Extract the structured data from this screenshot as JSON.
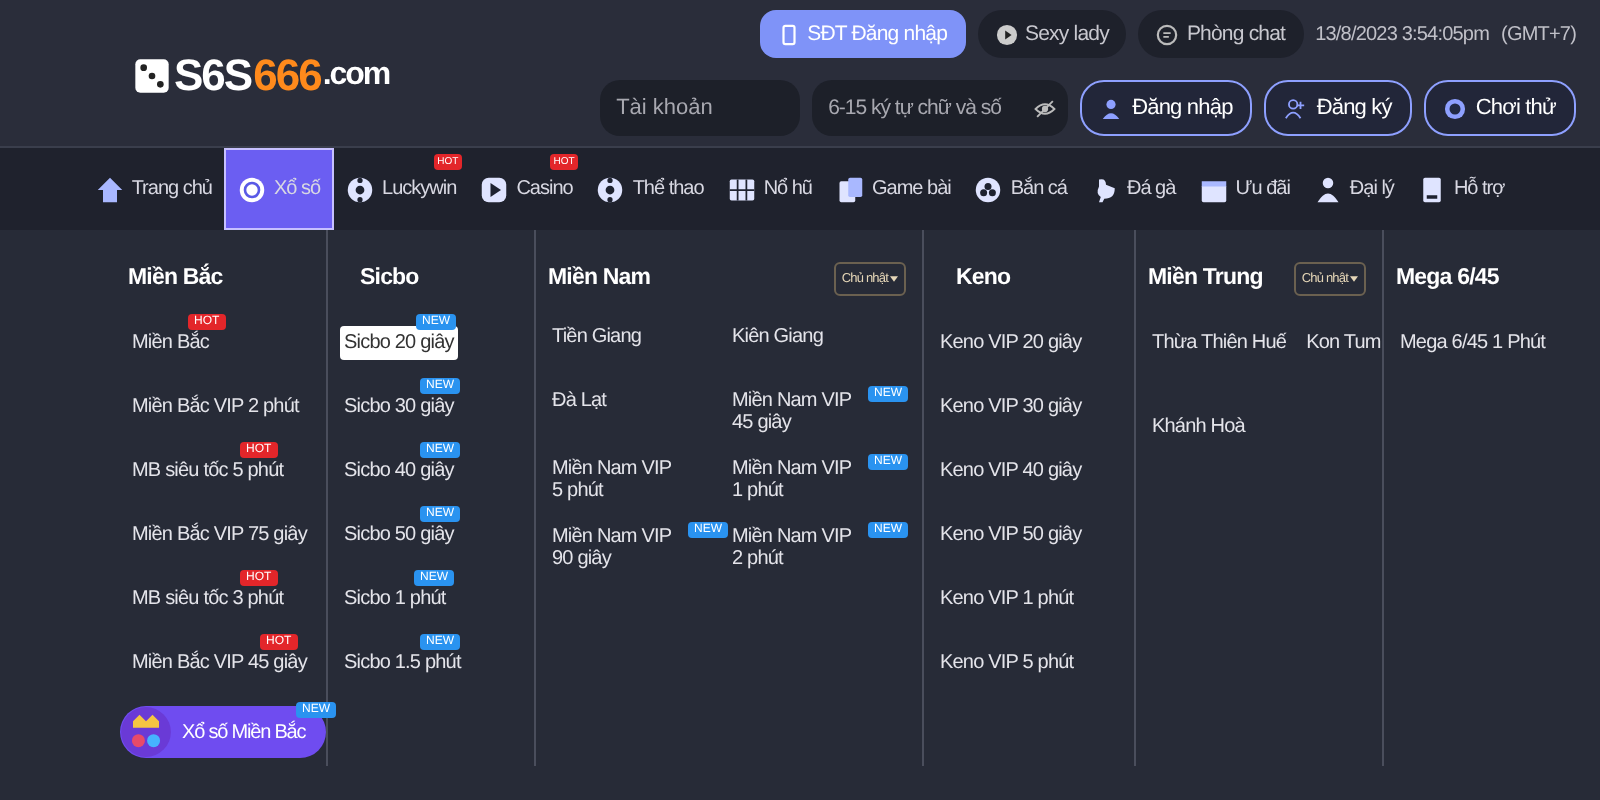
{
  "logo": {
    "prefix": "S6S",
    "accent": "666",
    "suffix": ".com"
  },
  "top_links": [
    {
      "label": "SĐT Đăng nhập",
      "kind": "primary"
    },
    {
      "label": "Sexy lady",
      "kind": "play"
    },
    {
      "label": "Phòng chat",
      "kind": "chat"
    }
  ],
  "clock": {
    "time": "13/8/2023 3:54:05pm",
    "zone": "(GMT+7)"
  },
  "login": {
    "account": {
      "placeholder": "Tài khoản"
    },
    "password": {
      "placeholder": "6-15 ký tự chữ và số"
    },
    "buttons": [
      {
        "label": "Đăng nhập",
        "kind": "login"
      },
      {
        "label": "Đăng ký",
        "kind": "register"
      },
      {
        "label": "Chơi thử",
        "kind": "trial"
      }
    ]
  },
  "nav": [
    {
      "label": "Trang chủ",
      "selected": false
    },
    {
      "label": "Xổ số",
      "selected": true
    },
    {
      "label": "Luckywin",
      "selected": false,
      "badge": "HOT"
    },
    {
      "label": "Casino",
      "selected": false,
      "badge": "HOT"
    },
    {
      "label": "Thể thao",
      "selected": false
    },
    {
      "label": "Nổ hũ",
      "selected": false
    },
    {
      "label": "Game bài",
      "selected": false
    },
    {
      "label": "Bắn cá",
      "selected": false
    },
    {
      "label": "Đá gà",
      "selected": false
    },
    {
      "label": "Ưu đãi",
      "selected": false
    },
    {
      "label": "Đại lý",
      "selected": false
    },
    {
      "label": "Hỗ trợ",
      "selected": false
    }
  ],
  "columns": [
    {
      "title": "Miền Bắc",
      "kind": "list",
      "items": [
        {
          "label": "Miền Bắc",
          "badge": {
            "text": "HOT",
            "kind": "hot"
          },
          "selected": false
        },
        {
          "label": "Miền Bắc VIP 2 phút",
          "selected": false
        },
        {
          "label": "MB siêu tốc 5 phút",
          "badge": {
            "text": "HOT",
            "kind": "hot"
          },
          "selected": false
        },
        {
          "label": "Miền Bắc VIP 75 giây",
          "selected": false
        },
        {
          "label": "MB siêu tốc 3 phút",
          "badge": {
            "text": "HOT",
            "kind": "hot"
          },
          "selected": false
        },
        {
          "label": "Miền Bắc VIP 45 giây",
          "badge": {
            "text": "HOT",
            "kind": "hot"
          },
          "selected": false
        },
        {
          "label": "Xổ số Miền Bắc",
          "kind": "feature",
          "badge": {
            "text": "NEW",
            "kind": "new"
          },
          "selected": false
        }
      ]
    },
    {
      "title": "Sicbo",
      "kind": "list",
      "items": [
        {
          "label": "Sicbo 20 giây",
          "badge": {
            "text": "NEW",
            "kind": "new"
          },
          "selected": true
        },
        {
          "label": "Sicbo 30 giây",
          "badge": {
            "text": "NEW",
            "kind": "new"
          },
          "selected": false
        },
        {
          "label": "Sicbo 40 giây",
          "badge": {
            "text": "NEW",
            "kind": "new"
          },
          "selected": false
        },
        {
          "label": "Sicbo 50 giây",
          "badge": {
            "text": "NEW",
            "kind": "new"
          },
          "selected": false
        },
        {
          "label": "Sicbo 1 phút",
          "badge": {
            "text": "NEW",
            "kind": "new"
          },
          "selected": false
        },
        {
          "label": "Sicbo 1.5 phút",
          "badge": {
            "text": "NEW",
            "kind": "new"
          },
          "selected": false
        }
      ]
    },
    {
      "title": "Miền Nam",
      "dropdown": "Chủ nhật",
      "kind": "grid",
      "items": [
        {
          "label": "Tiền Giang",
          "selected": false
        },
        {
          "label": "Kiên Giang",
          "selected": false
        },
        {
          "label": "Đà Lạt",
          "selected": false
        },
        {
          "label": "Miền Nam VIP 45 giây",
          "badge": {
            "text": "NEW",
            "kind": "new"
          },
          "selected": false
        },
        {
          "label": "Miền Nam VIP 5 phút",
          "selected": false
        },
        {
          "label": "Miền Nam VIP 1 phút",
          "badge": {
            "text": "NEW",
            "kind": "new"
          },
          "selected": false
        },
        {
          "label": "Miền Nam VIP 90 giây",
          "badge": {
            "text": "NEW",
            "kind": "new"
          },
          "selected": false
        },
        {
          "label": "Miền Nam VIP 2 phút",
          "badge": {
            "text": "NEW",
            "kind": "new"
          },
          "selected": false
        }
      ]
    },
    {
      "title": "Keno",
      "kind": "list",
      "items": [
        {
          "label": "Keno VIP 20 giây",
          "selected": false
        },
        {
          "label": "Keno VIP 30 giây",
          "selected": false
        },
        {
          "label": "Keno VIP 40 giây",
          "selected": false
        },
        {
          "label": "Keno VIP 50 giây",
          "selected": false
        },
        {
          "label": "Keno VIP 1 phút",
          "selected": false
        },
        {
          "label": "Keno VIP 5 phút",
          "selected": false
        }
      ]
    },
    {
      "title": "Miền Trung",
      "dropdown": "Chủ nhật",
      "kind": "tight",
      "items": [
        {
          "label": "Thừa Thiên Huế",
          "selected": false
        },
        {
          "label": "Kon Tum",
          "selected": false
        },
        {
          "label": "Khánh Hoà",
          "selected": false
        }
      ]
    },
    {
      "title": "Mega 6/45",
      "kind": "list",
      "items": [
        {
          "label": "Mega 6/45 1 Phút",
          "selected": false
        }
      ]
    }
  ]
}
